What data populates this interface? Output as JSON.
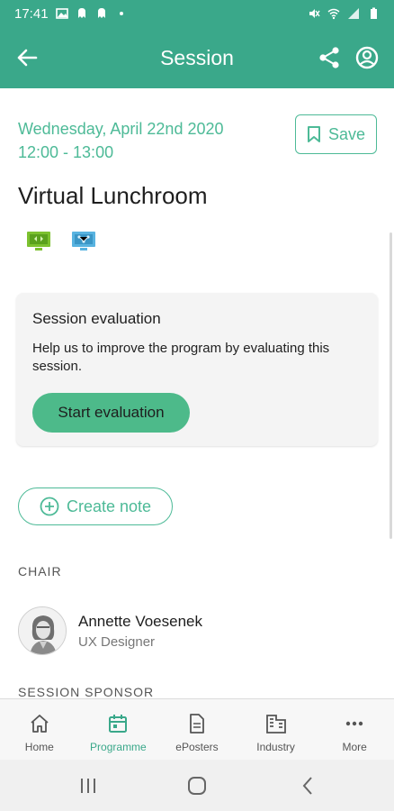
{
  "status_bar": {
    "time": "17:41",
    "left_icons": [
      "gallery-icon",
      "notification-icon",
      "notification-icon",
      "dot-icon"
    ],
    "right_icons": [
      "mute-icon",
      "wifi-icon",
      "signal-icon",
      "battery-icon"
    ]
  },
  "app_bar": {
    "title": "Session",
    "back_icon": "arrow-left-icon",
    "share_icon": "share-icon",
    "account_icon": "account-circle-icon",
    "color": "#3aa88a"
  },
  "session": {
    "date": "Wednesday, April 22nd 2020",
    "time": "12:00 - 13:00",
    "title": "Virtual Lunchroom",
    "save_label": "Save",
    "badges": [
      "virtual-screen-icon",
      "network-screen-icon"
    ]
  },
  "evaluation": {
    "title": "Session evaluation",
    "text": "Help us to improve the program by evaluating this session.",
    "button": "Start evaluation"
  },
  "note": {
    "button": "Create note"
  },
  "chair": {
    "label": "CHAIR",
    "name": "Annette Voesenek",
    "role": "UX Designer"
  },
  "sponsor": {
    "label": "SESSION SPONSOR"
  },
  "bottom_nav": {
    "items": [
      {
        "label": "Home",
        "icon": "home-icon"
      },
      {
        "label": "Programme",
        "icon": "calendar-icon",
        "active": true
      },
      {
        "label": "ePosters",
        "icon": "document-icon"
      },
      {
        "label": "Industry",
        "icon": "building-icon"
      },
      {
        "label": "More",
        "icon": "more-icon"
      }
    ]
  },
  "colors": {
    "accent": "#4dba97",
    "header": "#3aa88a",
    "button_fill": "#4dba8a"
  }
}
